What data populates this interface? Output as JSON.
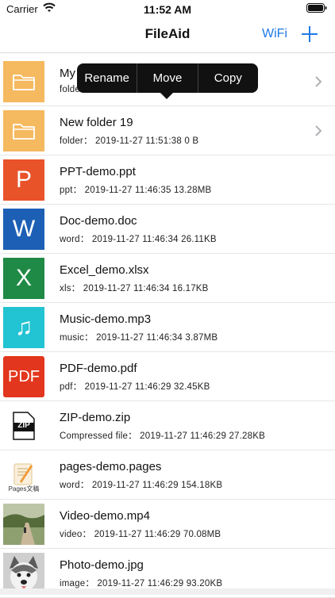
{
  "status_bar": {
    "carrier": "Carrier",
    "time": "11:52 AM",
    "wifi_icon": "wifi-icon",
    "battery_icon": "battery-icon"
  },
  "nav": {
    "title": "FileAid",
    "wifi_label": "WiFi",
    "add_icon": "plus-icon",
    "accent": "#1f7ae6"
  },
  "popover": {
    "items": [
      "Rename",
      "Move",
      "Copy"
    ]
  },
  "files": [
    {
      "name": "My",
      "meta": "folde",
      "type": "folder",
      "color": "#f5b95f"
    },
    {
      "name": "New folder 19",
      "meta": "folder： 2019-11-27 11:51:38 0 B",
      "type": "folder",
      "color": "#f5b95f"
    },
    {
      "name": "PPT-demo.ppt",
      "meta": "ppt： 2019-11-27 11:46:35 13.28MB",
      "type": "ppt",
      "color": "#e9532a",
      "letter": "P"
    },
    {
      "name": "Doc-demo.doc",
      "meta": "word： 2019-11-27 11:46:34 26.11KB",
      "type": "word",
      "color": "#1c5fb4",
      "letter": "W"
    },
    {
      "name": "Excel_demo.xlsx",
      "meta": "xls： 2019-11-27 11:46:34 16.17KB",
      "type": "xls",
      "color": "#1e8a45",
      "letter": "X"
    },
    {
      "name": "Music-demo.mp3",
      "meta": "music： 2019-11-27 11:46:34 3.87MB",
      "type": "music",
      "color": "#22c3d2",
      "letter": "♫"
    },
    {
      "name": "PDF-demo.pdf",
      "meta": "pdf： 2019-11-27 11:46:29 32.45KB",
      "type": "pdf",
      "color": "#e2361e",
      "letter": "PDF"
    },
    {
      "name": "ZIP-demo.zip",
      "meta": "Compressed file： 2019-11-27 11:46:29 27.28KB",
      "type": "zip",
      "color": "#111111",
      "letter": "ZIP"
    },
    {
      "name": "pages-demo.pages",
      "meta": "word： 2019-11-27 11:46:29 154.18KB",
      "type": "pages",
      "color": "#f29a35",
      "letter": "Pages文稿"
    },
    {
      "name": "Video-demo.mp4",
      "meta": "video： 2019-11-27 11:46:29 70.08MB",
      "type": "video",
      "color": "#6c7a4b"
    },
    {
      "name": "Photo-demo.jpg",
      "meta": "image： 2019-11-27 11:46:29 93.20KB",
      "type": "image",
      "color": "#9a9a9a"
    }
  ]
}
